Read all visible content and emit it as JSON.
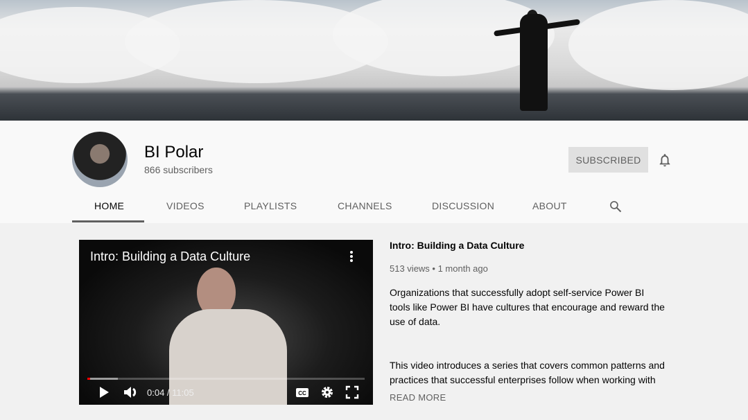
{
  "channel": {
    "name": "BI Polar",
    "subscribers": "866 subscribers",
    "subscribe_label": "SUBSCRIBED"
  },
  "tabs": [
    "HOME",
    "VIDEOS",
    "PLAYLISTS",
    "CHANNELS",
    "DISCUSSION",
    "ABOUT"
  ],
  "featured": {
    "title": "Intro: Building a Data Culture",
    "views": "513 views",
    "age": "1 month ago",
    "desc1": "Organizations that successfully adopt self-service Power BI tools like Power BI have cultures that encourage and reward the use of data.",
    "desc2": "This video introduces a series that covers common patterns and practices that successful enterprises follow when working with",
    "read_more": "READ MORE",
    "time": "0:04 / 11:05",
    "progress": 0.006,
    "buffered": 0.11
  }
}
